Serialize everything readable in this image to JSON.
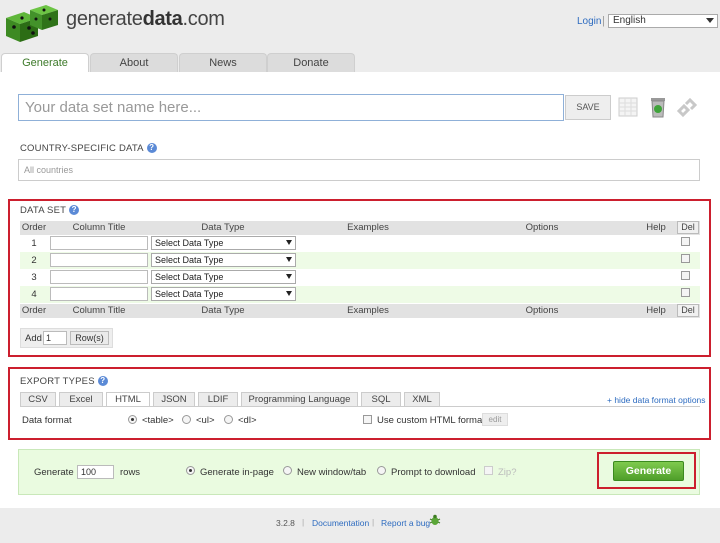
{
  "header": {
    "brand_prefix": "generate",
    "brand_bold": "data",
    "brand_suffix": ".com",
    "login": "Login",
    "separator": "|",
    "language": "English"
  },
  "tabs": [
    {
      "label": "Generate",
      "active": true
    },
    {
      "label": "About",
      "active": false
    },
    {
      "label": "News",
      "active": false
    },
    {
      "label": "Donate",
      "active": false
    }
  ],
  "dataset_name": {
    "placeholder": "Your data set name here...",
    "value": ""
  },
  "save_label": "SAVE",
  "toolbar_icons": [
    "spreadsheet-icon",
    "recycle-bin-icon",
    "link-icon"
  ],
  "country": {
    "label": "COUNTRY-SPECIFIC DATA",
    "value": "All countries"
  },
  "dataset": {
    "label": "DATA SET",
    "headers": {
      "order": "Order",
      "title": "Column Title",
      "type": "Data Type",
      "examples": "Examples",
      "options": "Options",
      "help": "Help",
      "del": "Del"
    },
    "rows": [
      {
        "order": "1",
        "title": "",
        "type": "Select Data Type"
      },
      {
        "order": "2",
        "title": "",
        "type": "Select Data Type"
      },
      {
        "order": "3",
        "title": "",
        "type": "Select Data Type"
      },
      {
        "order": "4",
        "title": "",
        "type": "Select Data Type"
      }
    ],
    "add_label": "Add",
    "add_count": "1",
    "rows_button": "Row(s)"
  },
  "export": {
    "label": "EXPORT TYPES",
    "tabs": [
      "CSV",
      "Excel",
      "HTML",
      "JSON",
      "LDIF",
      "Programming Language",
      "SQL",
      "XML"
    ],
    "active_tab": "HTML",
    "hide_link": "+ hide data format options",
    "format_label": "Data format",
    "formats": [
      {
        "label": "<table>",
        "selected": true
      },
      {
        "label": "<ul>",
        "selected": false
      },
      {
        "label": "<dl>",
        "selected": false
      }
    ],
    "custom_label": "Use custom HTML format",
    "edit_label": "edit"
  },
  "generate": {
    "label": "Generate",
    "rows_value": "100",
    "rows_label": "rows",
    "targets": [
      {
        "label": "Generate in-page",
        "selected": true
      },
      {
        "label": "New window/tab",
        "selected": false
      },
      {
        "label": "Prompt to download",
        "selected": false
      }
    ],
    "zip_label": "Zip?",
    "button": "Generate"
  },
  "footer": {
    "version": "3.2.8",
    "documentation": "Documentation",
    "report_bug": "Report a bug"
  },
  "colors": {
    "accent_green": "#4f9e2a",
    "link_blue": "#2e6cc0",
    "highlight_red": "#cc1f2e",
    "row_alt": "#eefbe6"
  }
}
